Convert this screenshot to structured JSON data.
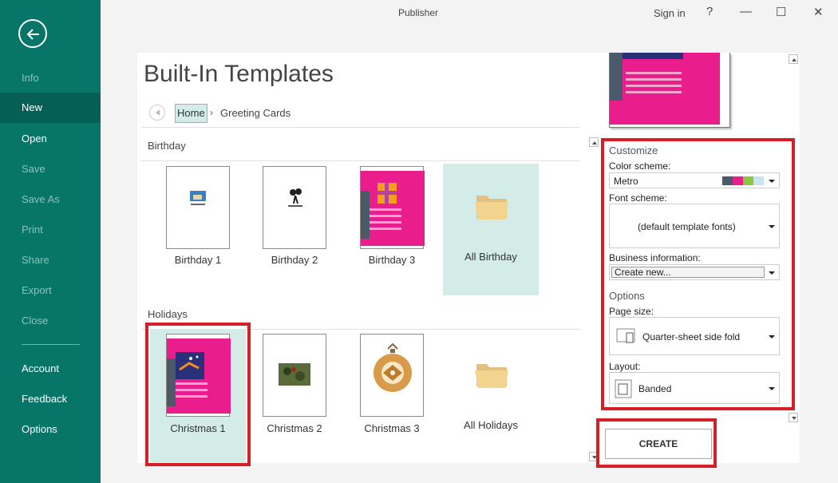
{
  "window": {
    "title": "Publisher",
    "sign_in": "Sign in",
    "help": "?",
    "minimize": "—",
    "maximize": "☐",
    "close": "✕"
  },
  "sidebar": {
    "items": [
      {
        "label": "Info"
      },
      {
        "label": "New"
      },
      {
        "label": "Open"
      },
      {
        "label": "Save"
      },
      {
        "label": "Save As"
      },
      {
        "label": "Print"
      },
      {
        "label": "Share"
      },
      {
        "label": "Export"
      },
      {
        "label": "Close"
      },
      {
        "label": "Account"
      },
      {
        "label": "Feedback"
      },
      {
        "label": "Options"
      }
    ],
    "active_item": "New",
    "bg_color": "#077568"
  },
  "main": {
    "title": "Built-In Templates",
    "breadcrumb": {
      "home": "Home",
      "separator": "›",
      "current": "Greeting Cards"
    },
    "sections": [
      {
        "name": "Birthday",
        "templates": [
          {
            "label": "Birthday  1"
          },
          {
            "label": "Birthday  2"
          },
          {
            "label": "Birthday  3"
          }
        ],
        "folder_label": "All Birthday"
      },
      {
        "name": "Holidays",
        "templates": [
          {
            "label": "Christmas  1"
          },
          {
            "label": "Christmas  2"
          },
          {
            "label": "Christmas  3"
          }
        ],
        "folder_label": "All Holidays"
      }
    ],
    "selected_template": "Christmas  1"
  },
  "customize": {
    "heading": "Customize",
    "color_scheme_label": "Color scheme:",
    "color_scheme_value": "Metro",
    "color_swatches": [
      "#4a5a6a",
      "#e91e8c",
      "#8cc63f",
      "#c9e5f3"
    ],
    "font_scheme_label": "Font scheme:",
    "font_scheme_value": "(default template fonts)",
    "business_info_label": "Business information:",
    "business_info_value": "Create new...",
    "options_heading": "Options",
    "page_size_label": "Page size:",
    "page_size_value": "Quarter-sheet side fold",
    "layout_label": "Layout:",
    "layout_value": "Banded"
  },
  "create_button": "CREATE",
  "accent_colors": {
    "highlight": "#d51f26",
    "selection": "#d4ece8",
    "card_pink": "#e91e8c"
  }
}
